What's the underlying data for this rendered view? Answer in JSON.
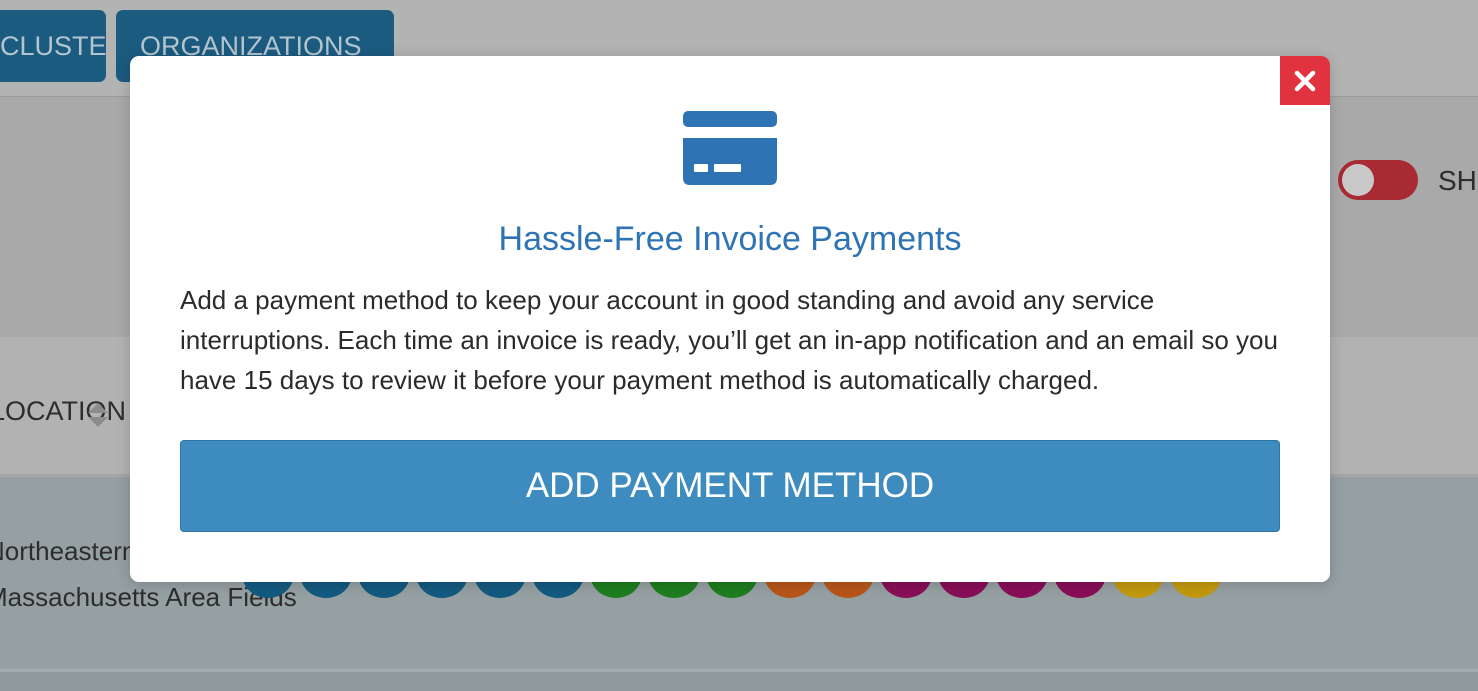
{
  "background": {
    "tabs": [
      {
        "label": "CLUSTERS"
      },
      {
        "label": "ORGANIZATIONS"
      }
    ],
    "table": {
      "column_header": "LOCATION",
      "rows": [
        {
          "location": "Northeastern M"
        },
        {
          "location": "Massachusetts Area Fields"
        }
      ]
    },
    "toggle": {
      "label": "SH",
      "state": "off",
      "color": "#a82a32"
    },
    "badge_colors": [
      "#135a80",
      "#135a80",
      "#135a80",
      "#135a80",
      "#135a80",
      "#135a80",
      "#1e7d1e",
      "#1e7d1e",
      "#1e7d1e",
      "#b8561a",
      "#b8561a",
      "#880e57",
      "#880e57",
      "#880e57",
      "#880e57",
      "#c2990f",
      "#c2990f"
    ]
  },
  "modal": {
    "icon": "credit-card-icon",
    "close_icon": "close-icon",
    "title": "Hassle-Free Invoice Payments",
    "body": "Add a payment method to keep your account in good standing and avoid any service interruptions. Each time an invoice is ready, you’ll get an in-app notification and an email so you have 15 days to review it before your payment method is automatically charged.",
    "primary_button": "ADD PAYMENT METHOD",
    "colors": {
      "accent": "#2e74b5",
      "button": "#3d8bbf",
      "close": "#e1333f"
    }
  }
}
